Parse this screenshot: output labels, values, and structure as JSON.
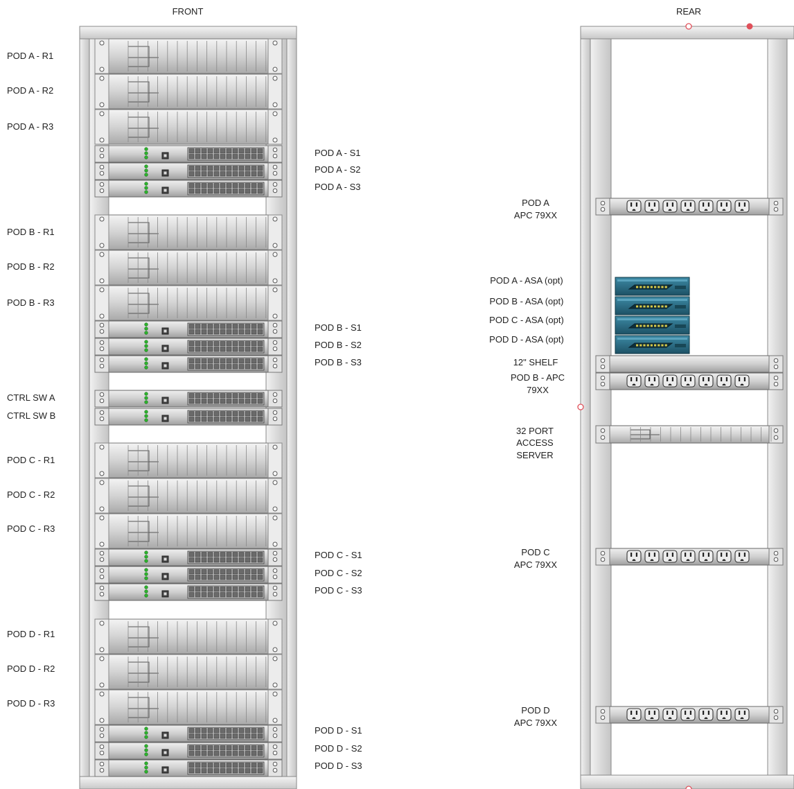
{
  "front": {
    "title": "FRONT",
    "groups": [
      {
        "routers": [
          "POD A - R1",
          "POD A - R2",
          "POD A - R3"
        ],
        "switches": [
          "POD A - S1",
          "POD A - S2",
          "POD A - S3"
        ]
      },
      {
        "routers": [
          "POD B - R1",
          "POD B - R2",
          "POD B - R3"
        ],
        "switches": [
          "POD B - S1",
          "POD B - S2",
          "POD B - S3"
        ]
      },
      {
        "routers": [
          "POD C - R1",
          "POD C - R2",
          "POD C - R3"
        ],
        "switches": [
          "POD C - S1",
          "POD C - S2",
          "POD C - S3"
        ]
      },
      {
        "routers": [
          "POD D - R1",
          "POD D - R2",
          "POD D - R3"
        ],
        "switches": [
          "POD D - S1",
          "POD D - S2",
          "POD D - S3"
        ]
      }
    ],
    "control_switches": [
      "CTRL SW A",
      "CTRL SW B"
    ]
  },
  "rear": {
    "title": "REAR",
    "pdu_pod_a": [
      "POD A",
      "APC 79XX"
    ],
    "asa_labels": [
      "POD A - ASA (opt)",
      "POD B - ASA (opt)",
      "POD C - ASA (opt)",
      "POD D - ASA (opt)"
    ],
    "shelf_label": "12\" SHELF",
    "pdu_pod_b": [
      "POD B - APC",
      "79XX"
    ],
    "access_server": [
      "32 PORT",
      "ACCESS",
      "SERVER"
    ],
    "pdu_pod_c": [
      "POD C",
      "APC 79XX"
    ],
    "pdu_pod_d": [
      "POD D",
      "APC 79XX"
    ]
  },
  "colors": {
    "rack_frame": "#d9d9d9",
    "device_body": "#dcdcdc",
    "led_green": "#2db52d",
    "asa_blue": "#2a6f86",
    "marker_red": "#e0505a"
  }
}
